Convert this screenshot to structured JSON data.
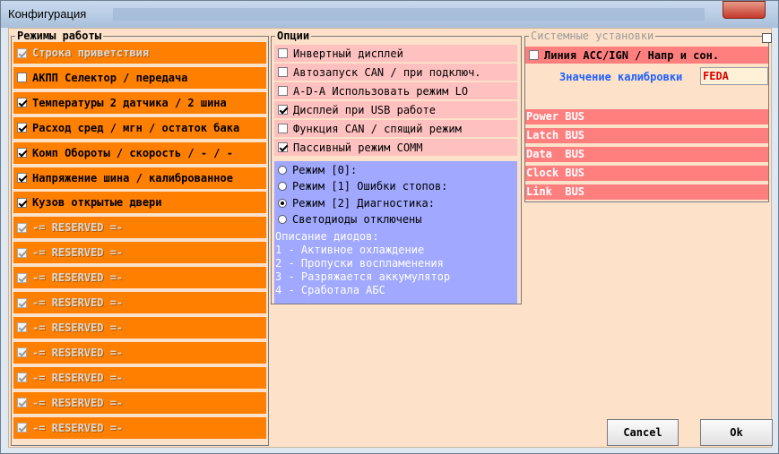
{
  "window": {
    "title": "Конфигурация"
  },
  "modes": {
    "legend": "Режимы работы",
    "items": [
      {
        "label": "Строка приветствия",
        "checked": true,
        "enabled": false
      },
      {
        "label": "АКПП Селектор / передача",
        "checked": false,
        "enabled": true
      },
      {
        "label": "Температуры 2 датчика / 2 шина",
        "checked": true,
        "enabled": true
      },
      {
        "label": "Расход сред / мгн / остаток бака",
        "checked": true,
        "enabled": true
      },
      {
        "label": "Комп Обороты / скорость / - / -",
        "checked": true,
        "enabled": true
      },
      {
        "label": "Напряжение шина / калиброванное",
        "checked": true,
        "enabled": true
      },
      {
        "label": "Кузов открытые двери",
        "checked": true,
        "enabled": true
      },
      {
        "label": "-= RESERVED =-",
        "checked": true,
        "enabled": false
      },
      {
        "label": "-= RESERVED =-",
        "checked": true,
        "enabled": false
      },
      {
        "label": "-= RESERVED =-",
        "checked": true,
        "enabled": false
      },
      {
        "label": "-= RESERVED =-",
        "checked": true,
        "enabled": false
      },
      {
        "label": "-= RESERVED =-",
        "checked": true,
        "enabled": false
      },
      {
        "label": "-= RESERVED =-",
        "checked": true,
        "enabled": false
      },
      {
        "label": "-= RESERVED =-",
        "checked": true,
        "enabled": false
      },
      {
        "label": "-= RESERVED =-",
        "checked": true,
        "enabled": false
      },
      {
        "label": "-= RESERVED =-",
        "checked": true,
        "enabled": false
      }
    ]
  },
  "options": {
    "legend": "Опции",
    "checkboxes": [
      {
        "label": "Инвертный дисплей",
        "checked": false
      },
      {
        "label": "Автозапуск CAN / при подключ.",
        "checked": false
      },
      {
        "label": "A-D-A Использовать режим LO",
        "checked": false
      },
      {
        "label": "Дисплей при USB работе",
        "checked": true
      },
      {
        "label": "Функция CAN / спящий режим",
        "checked": false
      },
      {
        "label": "Пассивный режим COMM",
        "checked": true
      }
    ],
    "radios": [
      {
        "label": "Режим [0]:",
        "selected": false
      },
      {
        "label": "Режим [1] Ошибки стопов:",
        "selected": false
      },
      {
        "label": "Режим [2] Диагностика:",
        "selected": true
      },
      {
        "label": "Светодиоды отключены",
        "selected": false
      }
    ],
    "description": [
      "Описание диодов:",
      "1 - Активное охлаждение",
      "2 - Пропуски воспламенения",
      "3 - Разряжается аккумулятор",
      "4 - Сработала АБС"
    ]
  },
  "system": {
    "legend": "Системные установки",
    "line_label": "Линия ACC/IGN / Напр и сон.",
    "line_checked": false,
    "calib_label": "Значение калибровки",
    "calib_value": "FEDA",
    "bus": [
      "Power BUS",
      "Latch BUS",
      "Data  BUS",
      "Clock BUS",
      "Link  BUS"
    ]
  },
  "buttons": {
    "cancel": "Cancel",
    "ok": "Ok"
  }
}
